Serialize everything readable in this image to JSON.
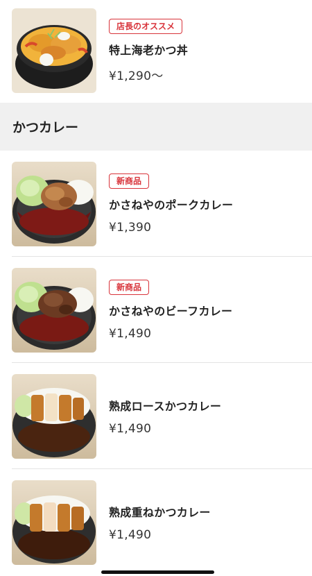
{
  "top_item": {
    "badge": "店長のオススメ",
    "name": "特上海老かつ丼",
    "price": "¥1,290～",
    "image_icon": "katsudon-bowl-image"
  },
  "section": {
    "title": "かつカレー"
  },
  "items": [
    {
      "badge": "新商品",
      "name": "かさねやのポークカレー",
      "price": "¥1,390"
    },
    {
      "badge": "新商品",
      "name": "かさねやのビーフカレー",
      "price": "¥1,490"
    },
    {
      "name": "熟成ロースかつカレー",
      "price": "¥1,490"
    },
    {
      "name": "熟成重ねかつカレー",
      "price": "¥1,490"
    }
  ],
  "colors": {
    "badge": "#d8333a",
    "section_bg": "#f0f0f0",
    "divider": "#e3e3e3"
  }
}
